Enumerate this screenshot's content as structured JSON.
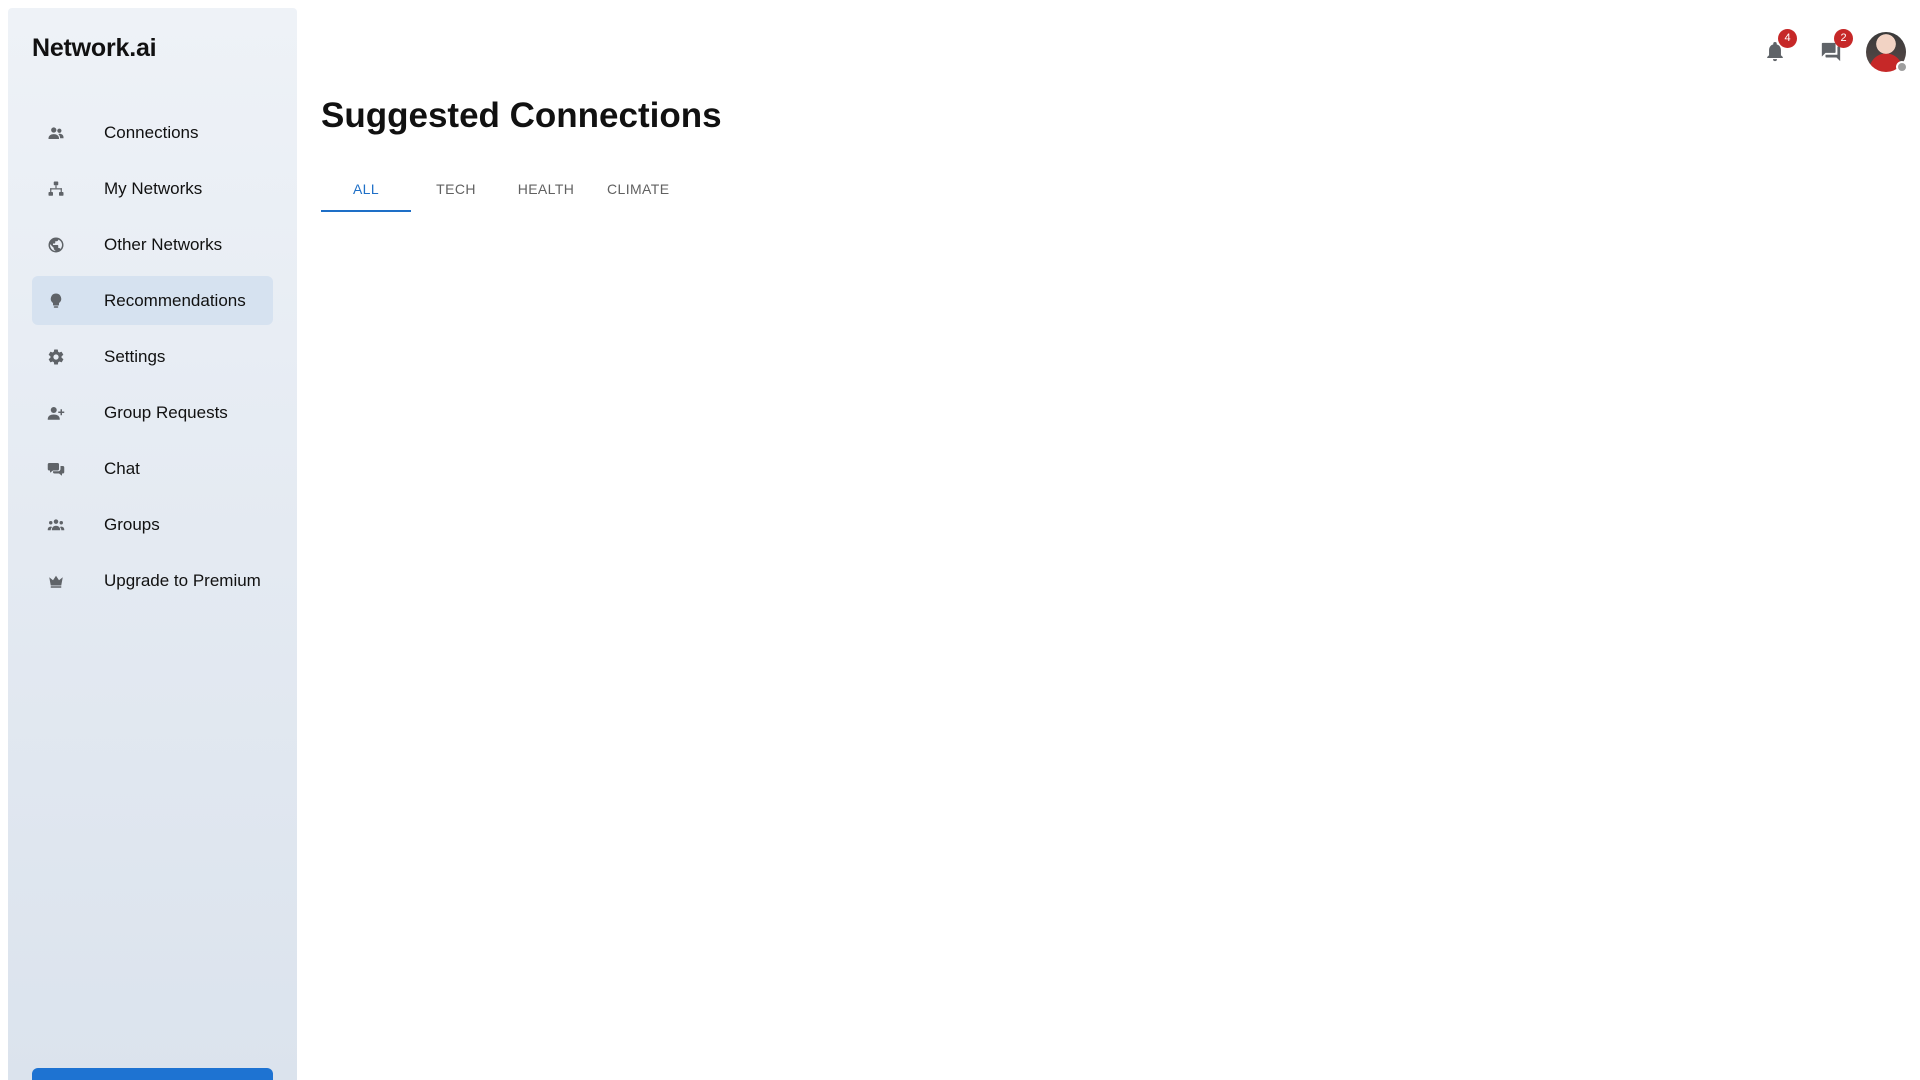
{
  "app": {
    "brand": "Network.ai"
  },
  "sidebar": {
    "items": [
      {
        "label": "Connections",
        "icon": "people-icon",
        "active": false
      },
      {
        "label": "My Networks",
        "icon": "network-tree-icon",
        "active": false
      },
      {
        "label": "Other Networks",
        "icon": "globe-icon",
        "active": false
      },
      {
        "label": "Recommendations",
        "icon": "lightbulb-icon",
        "active": true
      },
      {
        "label": "Settings",
        "icon": "gear-icon",
        "active": false
      },
      {
        "label": "Group Requests",
        "icon": "person-add-icon",
        "active": false
      },
      {
        "label": "Chat",
        "icon": "chat-bubbles-icon",
        "active": false
      },
      {
        "label": "Groups",
        "icon": "groups-icon",
        "active": false
      },
      {
        "label": "Upgrade to Premium",
        "icon": "crown-icon",
        "active": false
      }
    ]
  },
  "header": {
    "notifications_count": "4",
    "messages_count": "2",
    "avatar_status": "offline"
  },
  "main": {
    "title": "Suggested Connections",
    "tabs": [
      {
        "label": "ALL",
        "active": true
      },
      {
        "label": "TECH",
        "active": false
      },
      {
        "label": "HEALTH",
        "active": false
      },
      {
        "label": "CLIMATE",
        "active": false
      }
    ]
  },
  "colors": {
    "accent": "#1e6fc7",
    "badge": "#c62828",
    "active_nav_bg": "#d6e2f0",
    "primary_button": "#1e73d2"
  }
}
